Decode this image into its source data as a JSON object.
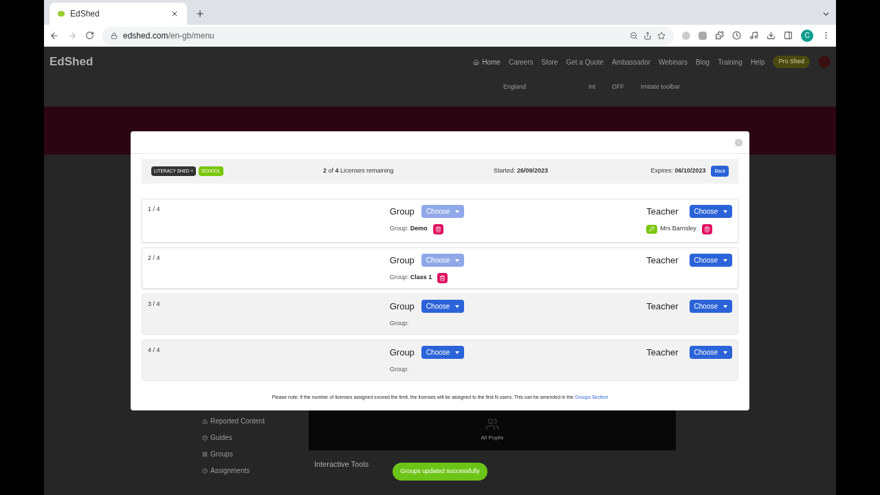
{
  "browser": {
    "tab_title": "EdShed",
    "url_host": "edshed.com",
    "url_path": "/en-gb/menu",
    "profile_initial": "C"
  },
  "site": {
    "logo": "EdShed",
    "nav": [
      "Home",
      "Careers",
      "Store",
      "Get a Quote",
      "Ambassador",
      "Webinars",
      "Blog",
      "Training",
      "Help"
    ],
    "pro_button": "Pro Shed",
    "region": "England",
    "toolbar": [
      "Int",
      "OFF",
      "Imitate toolbar"
    ]
  },
  "background": {
    "sidebar": [
      "Reported Content",
      "Guides",
      "Groups",
      "Assignments"
    ],
    "panel_label": "All Pupils",
    "section_title": "Interactive Tools"
  },
  "modal": {
    "badges": [
      {
        "label": "LITERACY SHED +",
        "color": "#333333"
      },
      {
        "label": "SCHOOL",
        "color": "#7ac70c"
      }
    ],
    "licenses": {
      "count": "2",
      "of": " of ",
      "total": "4",
      "suffix": " Licenses remaining"
    },
    "started": {
      "label": "Started: ",
      "value": "26/09/2023"
    },
    "expires": {
      "label": "Expires: ",
      "value": "06/10/2023"
    },
    "back_button": "Back",
    "rows": [
      {
        "number": "1 / 4",
        "kind": "assigned",
        "group_label": "Group",
        "group_button": "Choose",
        "group_disabled": true,
        "group_prefix": "Group: ",
        "group_value": "Demo",
        "teacher_label": "Teacher",
        "teacher_button": "Choose",
        "teacher_name": "Mrs Barnsley"
      },
      {
        "number": "2 / 4",
        "kind": "assigned",
        "group_label": "Group",
        "group_button": "Choose",
        "group_disabled": true,
        "group_prefix": "Group: ",
        "group_value": "Class 1",
        "teacher_label": "Teacher",
        "teacher_button": "Choose"
      },
      {
        "number": "3 / 4",
        "kind": "empty",
        "group_label": "Group",
        "group_button": "Choose",
        "group_disabled": false,
        "group_prefix": "Group:",
        "teacher_label": "Teacher",
        "teacher_button": "Choose"
      },
      {
        "number": "4 / 4",
        "kind": "empty",
        "group_label": "Group",
        "group_button": "Choose",
        "group_disabled": false,
        "group_prefix": "Group:",
        "teacher_label": "Teacher",
        "teacher_button": "Choose"
      }
    ],
    "note": "Please note: if the number of licenses assigned exceed the limit, the licenses will be assigned to the first N users. This can be amended in the",
    "note_link": "Groups Section"
  },
  "toast": "Groups updated successfully"
}
